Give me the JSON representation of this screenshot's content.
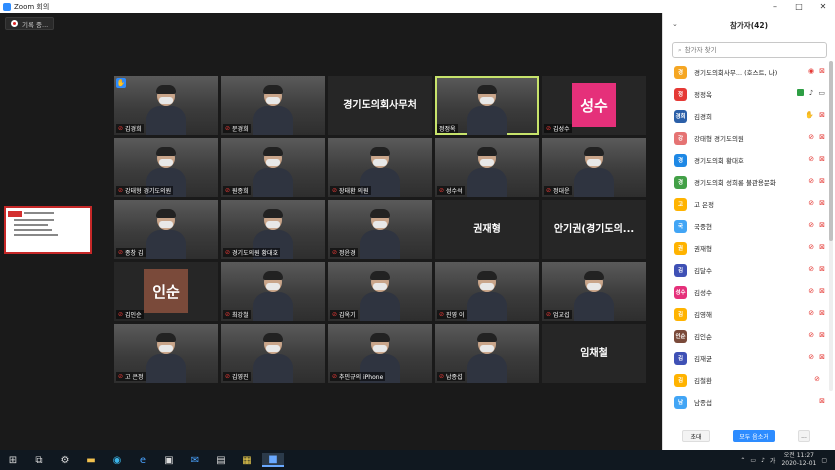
{
  "window": {
    "title": "Zoom 회의"
  },
  "recording": {
    "label": "기록 중..."
  },
  "tiles": [
    {
      "name": "김경희",
      "kind": "video",
      "muted": true,
      "hand": true
    },
    {
      "name": "문경희",
      "kind": "video",
      "muted": true
    },
    {
      "name": "경기도의회사무처",
      "kind": "text",
      "muted": false,
      "label": ""
    },
    {
      "name": "정정옥",
      "kind": "video",
      "muted": false,
      "active": true
    },
    {
      "name": "김성수",
      "kind": "avatar",
      "avatar": "성수",
      "avatar_color": "#e5307a",
      "muted": true
    },
    {
      "name": "강태형 경기도의원",
      "kind": "video",
      "muted": true
    },
    {
      "name": "원종희",
      "kind": "video",
      "muted": true
    },
    {
      "name": "장태환 의원",
      "kind": "video",
      "muted": true
    },
    {
      "name": "성수석",
      "kind": "video",
      "muted": true
    },
    {
      "name": "정대운",
      "kind": "video",
      "muted": true
    },
    {
      "name": "종창 김",
      "kind": "video",
      "muted": true
    },
    {
      "name": "경기도의원 황대호",
      "kind": "video",
      "muted": true
    },
    {
      "name": "정윤경",
      "kind": "video",
      "muted": true
    },
    {
      "name": "권재형",
      "kind": "text",
      "muted": false,
      "label": ""
    },
    {
      "name": "안기권(경기도의...",
      "kind": "text",
      "muted": false,
      "label": ""
    },
    {
      "name": "김인순",
      "kind": "avatar",
      "avatar": "인순",
      "avatar_color": "#7a4a3a",
      "muted": true
    },
    {
      "name": "최강철",
      "kind": "video",
      "muted": true
    },
    {
      "name": "김옥기",
      "kind": "video",
      "muted": true
    },
    {
      "name": "진영 이",
      "kind": "video",
      "muted": true
    },
    {
      "name": "엄교섭",
      "kind": "video",
      "muted": true
    },
    {
      "name": "고 은정",
      "kind": "video",
      "muted": true
    },
    {
      "name": "김영진",
      "kind": "video",
      "muted": true
    },
    {
      "name": "추민규의 iPhone",
      "kind": "video",
      "muted": true
    },
    {
      "name": "남종섭",
      "kind": "video",
      "muted": true
    },
    {
      "name": "임채철",
      "kind": "text",
      "muted": false,
      "label": ""
    }
  ],
  "panel": {
    "title": "참가자(42)",
    "search_placeholder": "참가자 찾기",
    "participants": [
      {
        "avatar": "경",
        "color": "#f5a623",
        "name": "경기도의회사무... (호스트, 나)",
        "mic": "rec",
        "cam": "off"
      },
      {
        "avatar": "정",
        "color": "#e53935",
        "name": "정정옥",
        "mic": "on",
        "cam": "on"
      },
      {
        "avatar": "경희",
        "color": "#2b5fa8",
        "name": "김경희",
        "mic": "hand",
        "cam": "off"
      },
      {
        "avatar": "강",
        "color": "#e57373",
        "name": "강태형 경기도의원",
        "mic": "off",
        "cam": "off"
      },
      {
        "avatar": "경",
        "color": "#1e88e5",
        "name": "경기도의회 황대호",
        "mic": "off",
        "cam": "off"
      },
      {
        "avatar": "경",
        "color": "#43a047",
        "name": "경기도의회 성희롱 불관용문화",
        "mic": "off",
        "cam": "off"
      },
      {
        "avatar": "고",
        "color": "#ffb300",
        "name": "고 은정",
        "mic": "off",
        "cam": "off"
      },
      {
        "avatar": "국",
        "color": "#42a5f5",
        "name": "국중현",
        "mic": "off",
        "cam": "off"
      },
      {
        "avatar": "권",
        "color": "#ffb300",
        "name": "권재형",
        "mic": "off",
        "cam": "off"
      },
      {
        "avatar": "김",
        "color": "#3f51b5",
        "name": "김달수",
        "mic": "off",
        "cam": "off"
      },
      {
        "avatar": "성수",
        "color": "#e5307a",
        "name": "김성수",
        "mic": "off",
        "cam": "off"
      },
      {
        "avatar": "김",
        "color": "#ffb300",
        "name": "김영해",
        "mic": "off",
        "cam": "off"
      },
      {
        "avatar": "인순",
        "color": "#7a4a3a",
        "name": "김인순",
        "mic": "off",
        "cam": "off"
      },
      {
        "avatar": "김",
        "color": "#3f51b5",
        "name": "김재균",
        "mic": "off",
        "cam": "off"
      },
      {
        "avatar": "김",
        "color": "#ffb300",
        "name": "김철환",
        "mic": "off",
        "cam": "none"
      },
      {
        "avatar": "남",
        "color": "#42a5f5",
        "name": "남종섭",
        "mic": "none",
        "cam": "off"
      }
    ],
    "invite_label": "초대",
    "mute_all_label": "모두 음소거",
    "more_label": "..."
  },
  "taskbar": {
    "time": "오전 11:27",
    "date": "2020-12-01"
  }
}
